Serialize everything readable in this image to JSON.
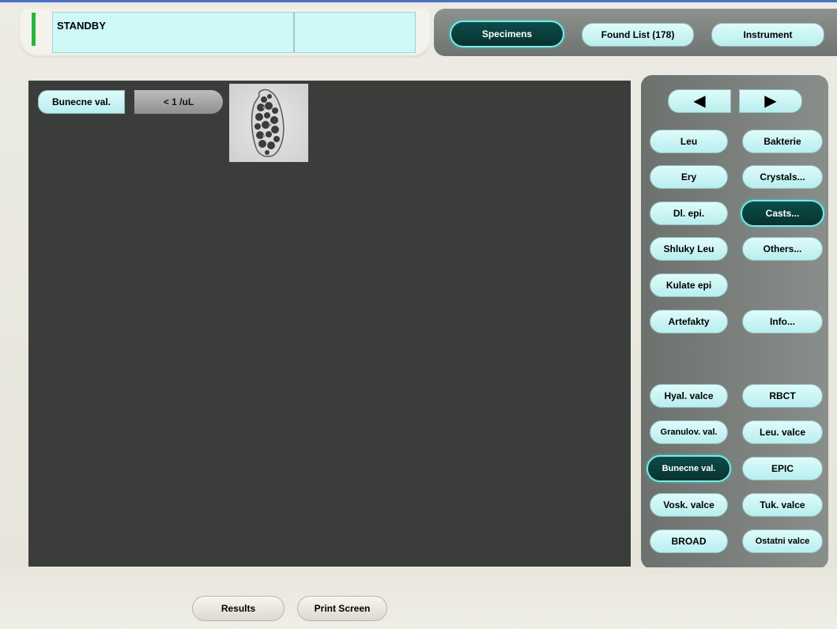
{
  "status": {
    "text": "STANDBY",
    "indicator_color": "#29b53d",
    "box_color": "#cff8f8"
  },
  "nav": {
    "tabs": [
      {
        "label": "Specimens",
        "active": true
      },
      {
        "label": "Found List (178)",
        "active": false
      },
      {
        "label": "Instrument",
        "active": false
      }
    ]
  },
  "viewer": {
    "category_label": "Bunecne val.",
    "concentration": "< 1 /uL",
    "thumbnail_icon": "cast-cell-image"
  },
  "classifier": {
    "prev_icon": "left-triangle-icon",
    "next_icon": "right-triangle-icon",
    "main": {
      "leu": "Leu",
      "bakterie": "Bakterie",
      "ery": "Ery",
      "crystals": "Crystals...",
      "dl_epi": "Dl. epi.",
      "casts": "Casts...",
      "shluky_leu": "Shluky Leu",
      "others": "Others...",
      "kulate_epi": "Kulate epi",
      "artefakty": "Artefakty",
      "info": "Info..."
    },
    "casts": {
      "hyal_valce": "Hyal. valce",
      "rbct": "RBCT",
      "granulov_val": "Granulov. val.",
      "leu_valce": "Leu. valce",
      "bunecne_val": "Bunecne val.",
      "epic": "EPIC",
      "vosk_valce": "Vosk. valce",
      "tuk_valce": "Tuk. valce",
      "broad": "BROAD",
      "ostatni_valce": "Ostatni valce"
    }
  },
  "footer": {
    "results": "Results",
    "print_screen": "Print Screen"
  },
  "colors": {
    "accent_active": "#0c4c4a",
    "button_fill": "#c9f4f4",
    "viewer_bg": "#3b3d3b"
  }
}
